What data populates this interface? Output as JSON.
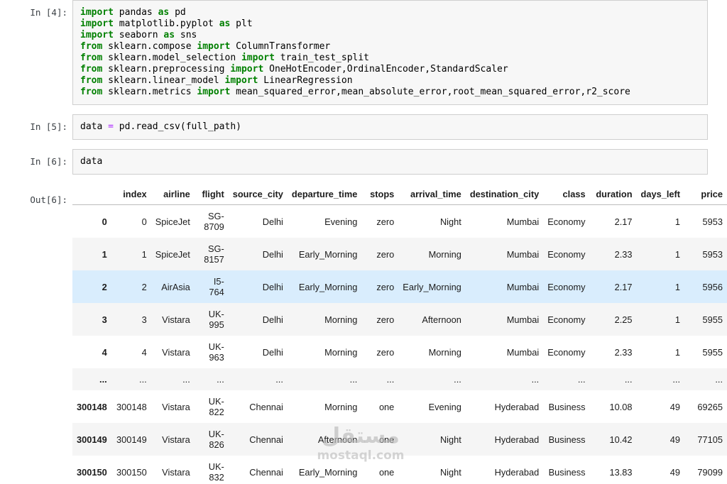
{
  "cells": [
    {
      "prompt": "In [4]:",
      "lines": [
        [
          {
            "t": "import",
            "c": "kw"
          },
          {
            "t": " pandas "
          },
          {
            "t": "as",
            "c": "kw"
          },
          {
            "t": " pd"
          }
        ],
        [
          {
            "t": "import",
            "c": "kw"
          },
          {
            "t": " matplotlib.pyplot "
          },
          {
            "t": "as",
            "c": "kw"
          },
          {
            "t": " plt"
          }
        ],
        [
          {
            "t": "import",
            "c": "kw"
          },
          {
            "t": " seaborn "
          },
          {
            "t": "as",
            "c": "kw"
          },
          {
            "t": " sns"
          }
        ],
        [
          {
            "t": "from",
            "c": "kw"
          },
          {
            "t": " sklearn.compose "
          },
          {
            "t": "import",
            "c": "kw"
          },
          {
            "t": " ColumnTransformer"
          }
        ],
        [
          {
            "t": "from",
            "c": "kw"
          },
          {
            "t": " sklearn.model_selection "
          },
          {
            "t": "import",
            "c": "kw"
          },
          {
            "t": " train_test_split"
          }
        ],
        [
          {
            "t": "from",
            "c": "kw"
          },
          {
            "t": " sklearn.preprocessing "
          },
          {
            "t": "import",
            "c": "kw"
          },
          {
            "t": " OneHotEncoder,OrdinalEncoder,StandardScaler"
          }
        ],
        [
          {
            "t": "from",
            "c": "kw"
          },
          {
            "t": " sklearn.linear_model "
          },
          {
            "t": "import",
            "c": "kw"
          },
          {
            "t": " LinearRegression"
          }
        ],
        [
          {
            "t": "from",
            "c": "kw"
          },
          {
            "t": " sklearn.metrics "
          },
          {
            "t": "import",
            "c": "kw"
          },
          {
            "t": " mean_squared_error,mean_absolute_error,root_mean_squared_error,r2_score"
          }
        ]
      ]
    },
    {
      "prompt": "In [5]:",
      "lines": [
        [
          {
            "t": "data "
          },
          {
            "t": "=",
            "c": "op"
          },
          {
            "t": " pd.read_csv(full_path)"
          }
        ]
      ]
    },
    {
      "prompt": "In [6]:",
      "lines": [
        [
          {
            "t": "data"
          }
        ]
      ]
    }
  ],
  "output": {
    "prompt": "Out[6]:",
    "table": {
      "headers": [
        "",
        "index",
        "airline",
        "flight",
        "source_city",
        "departure_time",
        "stops",
        "arrival_time",
        "destination_city",
        "class",
        "duration",
        "days_left",
        "price"
      ],
      "rows": [
        {
          "label": "0",
          "cells": [
            "0",
            "SpiceJet",
            "SG-8709",
            "Delhi",
            "Evening",
            "zero",
            "Night",
            "Mumbai",
            "Economy",
            "2.17",
            "1",
            "5953"
          ]
        },
        {
          "label": "1",
          "cells": [
            "1",
            "SpiceJet",
            "SG-8157",
            "Delhi",
            "Early_Morning",
            "zero",
            "Morning",
            "Mumbai",
            "Economy",
            "2.33",
            "1",
            "5953"
          ],
          "shade": true
        },
        {
          "label": "2",
          "cells": [
            "2",
            "AirAsia",
            "I5-764",
            "Delhi",
            "Early_Morning",
            "zero",
            "Early_Morning",
            "Mumbai",
            "Economy",
            "2.17",
            "1",
            "5956"
          ],
          "highlight": true
        },
        {
          "label": "3",
          "cells": [
            "3",
            "Vistara",
            "UK-995",
            "Delhi",
            "Morning",
            "zero",
            "Afternoon",
            "Mumbai",
            "Economy",
            "2.25",
            "1",
            "5955"
          ],
          "shade": true
        },
        {
          "label": "4",
          "cells": [
            "4",
            "Vistara",
            "UK-963",
            "Delhi",
            "Morning",
            "zero",
            "Morning",
            "Mumbai",
            "Economy",
            "2.33",
            "1",
            "5955"
          ]
        },
        {
          "label": "...",
          "cells": [
            "...",
            "...",
            "...",
            "...",
            "...",
            "...",
            "...",
            "...",
            "...",
            "...",
            "...",
            "..."
          ],
          "shade": true
        },
        {
          "label": "300148",
          "cells": [
            "300148",
            "Vistara",
            "UK-822",
            "Chennai",
            "Morning",
            "one",
            "Evening",
            "Hyderabad",
            "Business",
            "10.08",
            "49",
            "69265"
          ]
        },
        {
          "label": "300149",
          "cells": [
            "300149",
            "Vistara",
            "UK-826",
            "Chennai",
            "Afternoon",
            "one",
            "Night",
            "Hyderabad",
            "Business",
            "10.42",
            "49",
            "77105"
          ],
          "shade": true
        },
        {
          "label": "300150",
          "cells": [
            "300150",
            "Vistara",
            "UK-832",
            "Chennai",
            "Early_Morning",
            "one",
            "Night",
            "Hyderabad",
            "Business",
            "13.83",
            "49",
            "79099"
          ]
        }
      ]
    }
  },
  "watermark": {
    "line1": "مستقل",
    "line2": "mostaql.com"
  },
  "colors": {
    "keyword": "#008000",
    "operator": "#AA22FF",
    "cell_background": "#f7f7f7",
    "cell_border": "#cfcfcf",
    "row_shade": "#f5f5f5",
    "row_highlight": "#d9edfd",
    "prompt_text": "#3b4045"
  }
}
